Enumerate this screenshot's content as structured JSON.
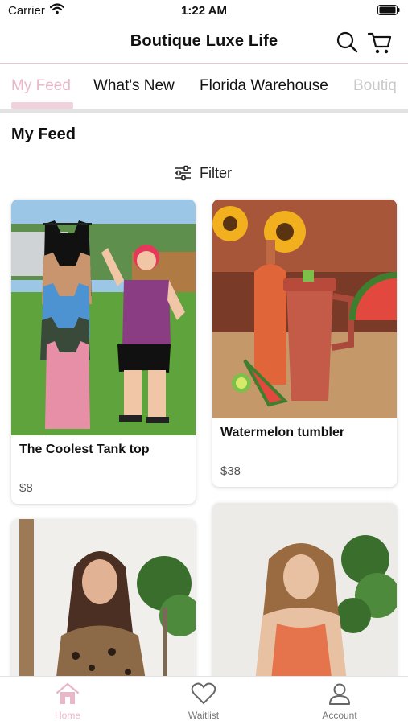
{
  "status": {
    "carrier": "Carrier",
    "time": "1:22 AM"
  },
  "header": {
    "title": "Boutique Luxe Life"
  },
  "tabs": [
    "My Feed",
    "What's New",
    "Florida Warehouse",
    "Boutiq"
  ],
  "feed": {
    "title": "My Feed",
    "filter_label": "Filter"
  },
  "products": [
    {
      "name": "The Coolest Tank top",
      "price": "$8"
    },
    {
      "name": "Watermelon tumbler",
      "price": "$38"
    },
    {
      "name": "",
      "price": ""
    },
    {
      "name": "",
      "price": ""
    }
  ],
  "nav": [
    {
      "label": "Home",
      "icon": "home-icon"
    },
    {
      "label": "Waitlist",
      "icon": "heart-icon"
    },
    {
      "label": "Account",
      "icon": "person-icon"
    }
  ],
  "colors": {
    "accent": "#eab7c8",
    "tab_underline": "#f1d1dc"
  }
}
